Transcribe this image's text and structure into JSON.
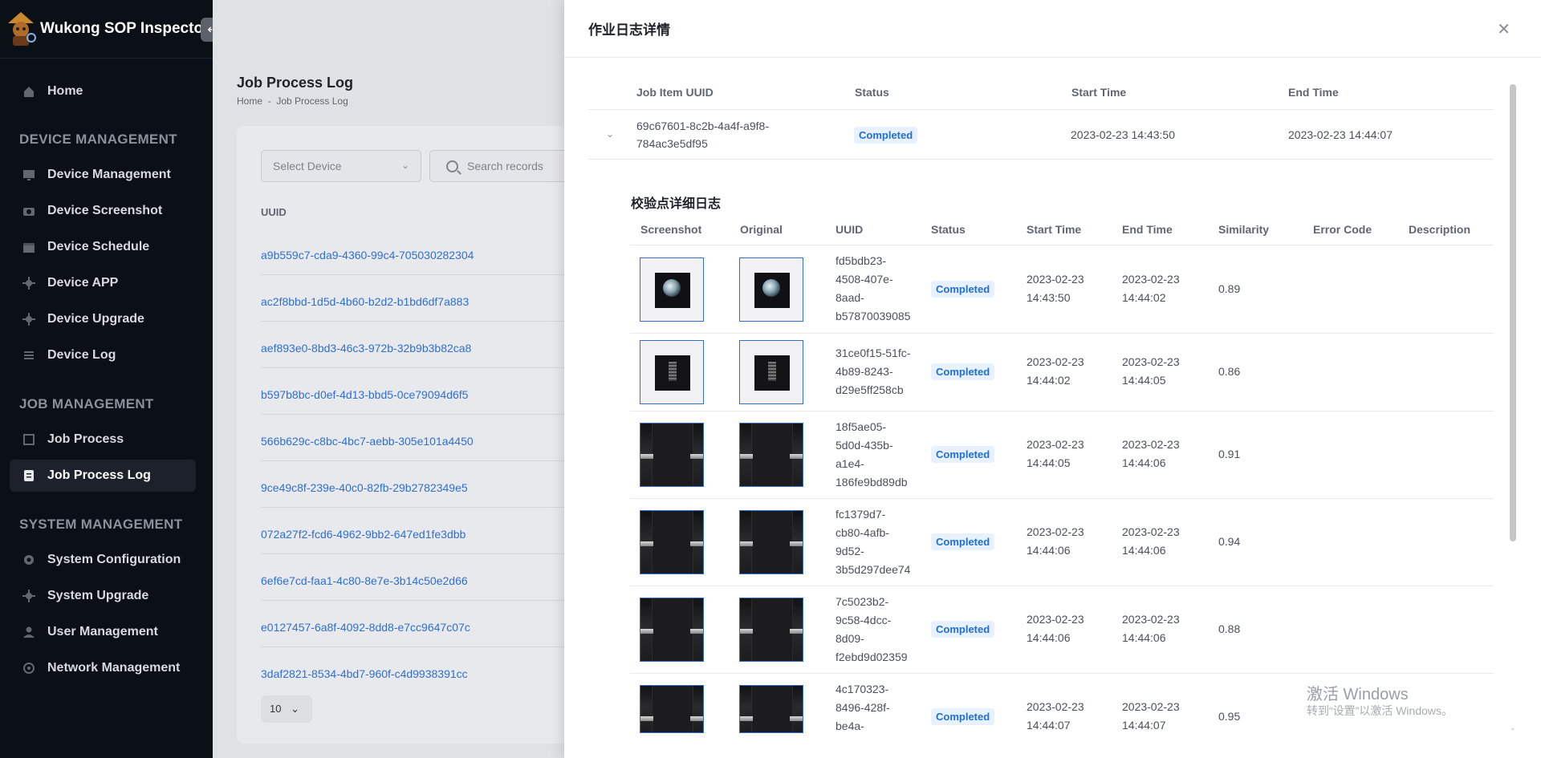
{
  "app": {
    "title": "Wukong SOP Inspector"
  },
  "sidebar": {
    "home": "Home",
    "sections": {
      "device": "DEVICE MANAGEMENT",
      "job": "JOB MANAGEMENT",
      "system": "SYSTEM MANAGEMENT"
    },
    "device_items": [
      "Device Management",
      "Device Screenshot",
      "Device Schedule",
      "Device APP",
      "Device Upgrade",
      "Device Log"
    ],
    "job_items": [
      "Job Process",
      "Job Process Log"
    ],
    "system_items": [
      "System Configuration",
      "System Upgrade",
      "User Management",
      "Network Management"
    ],
    "active_item": "Job Process Log"
  },
  "page": {
    "title": "Job Process Log",
    "breadcrumb": {
      "home": "Home",
      "sep": "-",
      "current": "Job Process Log"
    },
    "filters": {
      "device_placeholder": "Select Device",
      "search_placeholder": "Search records"
    },
    "column_uuid": "UUID",
    "uuids": [
      "a9b559c7-cda9-4360-99c4-705030282304",
      "ac2f8bbd-1d5d-4b60-b2d2-b1bd6df7a883",
      "aef893e0-8bd3-46c3-972b-32b9b3b82ca8",
      "b597b8bc-d0ef-4d13-bbd5-0ce79094d6f5",
      "566b629c-c8bc-4bc7-aebb-305e101a4450",
      "9ce49c8f-239e-40c0-82fb-29b2782349e5",
      "072a27f2-fcd6-4962-9bb2-647ed1fe3dbb",
      "6ef6e7cd-faa1-4c80-8e7e-3b14c50e2d66",
      "e0127457-6a8f-4092-8dd8-e7cc9647c07c",
      "3daf2821-8534-4bd7-960f-c4d9938391cc"
    ],
    "page_size": "10"
  },
  "drawer": {
    "title": "作业日志详情",
    "columns": {
      "job_item_uuid": "Job Item UUID",
      "status": "Status",
      "start": "Start Time",
      "end": "End Time"
    },
    "job": {
      "uuid_line1": "69c67601-8c2b-4a4f-a9f8-",
      "uuid_line2": "784ac3e5df95",
      "status": "Completed",
      "start": "2023-02-23 14:43:50",
      "end": "2023-02-23 14:44:07"
    },
    "detail_title": "校验点详细日志",
    "detail_columns": {
      "screenshot": "Screenshot",
      "original": "Original",
      "uuid": "UUID",
      "status": "Status",
      "start": "Start Time",
      "end": "End Time",
      "similarity": "Similarity",
      "error": "Error Code",
      "desc": "Description"
    },
    "rows": [
      {
        "uuid": [
          "fd5bdb23-",
          "4508-407e-",
          "8aad-",
          "b57870039085"
        ],
        "status": "Completed",
        "start": [
          "2023-02-23",
          "14:43:50"
        ],
        "end": [
          "2023-02-23",
          "14:44:02"
        ],
        "similarity": "0.89"
      },
      {
        "uuid": [
          "31ce0f15-51fc-",
          "4b89-8243-",
          "d29e5ff258cb"
        ],
        "status": "Completed",
        "start": [
          "2023-02-23",
          "14:44:02"
        ],
        "end": [
          "2023-02-23",
          "14:44:05"
        ],
        "similarity": "0.86"
      },
      {
        "uuid": [
          "18f5ae05-",
          "5d0d-435b-",
          "a1e4-",
          "186fe9bd89db"
        ],
        "status": "Completed",
        "start": [
          "2023-02-23",
          "14:44:05"
        ],
        "end": [
          "2023-02-23",
          "14:44:06"
        ],
        "similarity": "0.91"
      },
      {
        "uuid": [
          "fc1379d7-",
          "cb80-4afb-",
          "9d52-",
          "3b5d297dee74"
        ],
        "status": "Completed",
        "start": [
          "2023-02-23",
          "14:44:06"
        ],
        "end": [
          "2023-02-23",
          "14:44:06"
        ],
        "similarity": "0.94"
      },
      {
        "uuid": [
          "7c5023b2-",
          "9c58-4dcc-",
          "8d09-",
          "f2ebd9d02359"
        ],
        "status": "Completed",
        "start": [
          "2023-02-23",
          "14:44:06"
        ],
        "end": [
          "2023-02-23",
          "14:44:06"
        ],
        "similarity": "0.88"
      },
      {
        "uuid": [
          "4c170323-",
          "8496-428f-",
          "be4a-"
        ],
        "status": "Completed",
        "start": [
          "2023-02-23",
          "14:44:07"
        ],
        "end": [
          "2023-02-23",
          "14:44:07"
        ],
        "similarity": "0.95"
      }
    ]
  },
  "watermark": {
    "line1": "激活 Windows",
    "line2": "转到“设置”以激活 Windows。"
  },
  "icons": {
    "collapse": "arrow-left-icon",
    "close": "close-icon",
    "expand": "chevron-down-icon",
    "search": "search-icon"
  },
  "colors": {
    "accent": "#2f6fd1",
    "sidebar_bg": "#0b0f16",
    "badge_bg": "#e7f1ff"
  }
}
